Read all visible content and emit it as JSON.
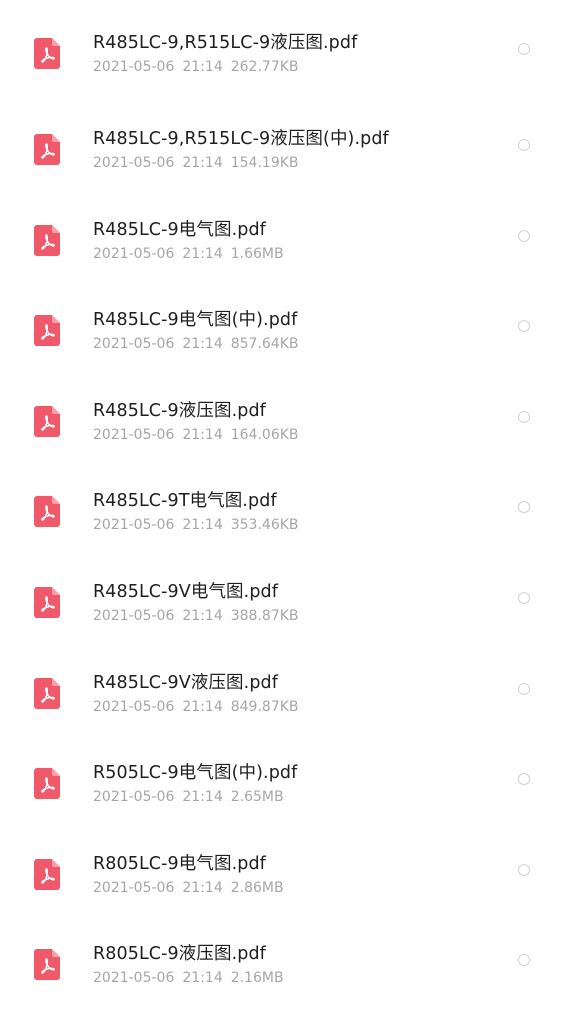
{
  "colors": {
    "pdf_icon": "#f0596a",
    "name_text": "#1e1e1e",
    "meta_text": "#a6a6a6",
    "radio_border": "#d2d2d2"
  },
  "files": [
    {
      "name": "R485LC-9,R515LC-9液压图.pdf",
      "date": "2021-05-06",
      "time": "21:14",
      "size": "262.77KB",
      "icon": "pdf-file-icon"
    },
    {
      "name": "R485LC-9,R515LC-9液压图(中).pdf",
      "date": "2021-05-06",
      "time": "21:14",
      "size": "154.19KB",
      "icon": "pdf-file-icon"
    },
    {
      "name": "R485LC-9电气图.pdf",
      "date": "2021-05-06",
      "time": "21:14",
      "size": "1.66MB",
      "icon": "pdf-file-icon"
    },
    {
      "name": "R485LC-9电气图(中).pdf",
      "date": "2021-05-06",
      "time": "21:14",
      "size": "857.64KB",
      "icon": "pdf-file-icon"
    },
    {
      "name": "R485LC-9液压图.pdf",
      "date": "2021-05-06",
      "time": "21:14",
      "size": "164.06KB",
      "icon": "pdf-file-icon"
    },
    {
      "name": "R485LC-9T电气图.pdf",
      "date": "2021-05-06",
      "time": "21:14",
      "size": "353.46KB",
      "icon": "pdf-file-icon"
    },
    {
      "name": "R485LC-9V电气图.pdf",
      "date": "2021-05-06",
      "time": "21:14",
      "size": "388.87KB",
      "icon": "pdf-file-icon"
    },
    {
      "name": "R485LC-9V液压图.pdf",
      "date": "2021-05-06",
      "time": "21:14",
      "size": "849.87KB",
      "icon": "pdf-file-icon"
    },
    {
      "name": "R505LC-9电气图(中).pdf",
      "date": "2021-05-06",
      "time": "21:14",
      "size": "2.65MB",
      "icon": "pdf-file-icon"
    },
    {
      "name": "R805LC-9电气图.pdf",
      "date": "2021-05-06",
      "time": "21:14",
      "size": "2.86MB",
      "icon": "pdf-file-icon"
    },
    {
      "name": "R805LC-9液压图.pdf",
      "date": "2021-05-06",
      "time": "21:14",
      "size": "2.16MB",
      "icon": "pdf-file-icon"
    }
  ]
}
